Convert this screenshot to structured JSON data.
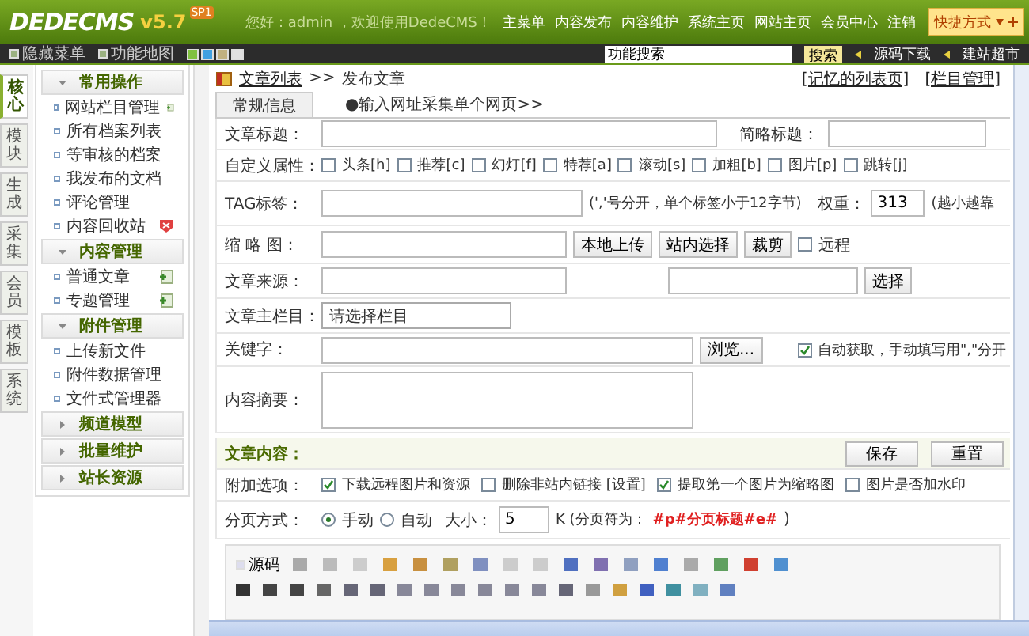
{
  "header": {
    "logo": "DEDECMS",
    "version": "v5.7",
    "badge": "SP1",
    "greeting": "您好：admin ，欢迎使用DedeCMS！",
    "nav": [
      "主菜单",
      "内容发布",
      "内容维护",
      "系统主页",
      "网站主页",
      "会员中心",
      "注销"
    ],
    "shortcut": "快捷方式"
  },
  "toolbar": {
    "items": [
      "隐藏菜单",
      "功能地图"
    ],
    "search_value": "功能搜索",
    "search_button": "搜索",
    "links": [
      "源码下载",
      "建站超市"
    ]
  },
  "side_tabs": [
    {
      "label": "核心",
      "selected": true
    },
    {
      "label": "模块",
      "selected": false
    },
    {
      "label": "生成",
      "selected": false
    },
    {
      "label": "采集",
      "selected": false
    },
    {
      "label": "会员",
      "selected": false
    },
    {
      "label": "模板",
      "selected": false
    },
    {
      "label": "系统",
      "selected": false
    }
  ],
  "menu": [
    {
      "title": "常用操作",
      "expanded": true,
      "items": [
        {
          "label": "网站栏目管理",
          "kind": "add"
        },
        {
          "label": "所有档案列表"
        },
        {
          "label": "等审核的档案"
        },
        {
          "label": "我发布的文档"
        },
        {
          "label": "评论管理"
        },
        {
          "label": "内容回收站",
          "kind": "delete"
        }
      ]
    },
    {
      "title": "内容管理",
      "expanded": true,
      "items": [
        {
          "label": "普通文章",
          "kind": "add"
        },
        {
          "label": "专题管理",
          "kind": "add"
        }
      ]
    },
    {
      "title": "附件管理",
      "expanded": true,
      "items": [
        {
          "label": "上传新文件"
        },
        {
          "label": "附件数据管理"
        },
        {
          "label": "文件式管理器"
        }
      ]
    },
    {
      "title": "频道模型",
      "expanded": false
    },
    {
      "title": "批量维护",
      "expanded": false
    },
    {
      "title": "站长资源",
      "expanded": false
    }
  ],
  "main": {
    "breadcrumb_link": "文章列表",
    "breadcrumb_sep": ">>",
    "breadcrumb_current": "发布文章",
    "right_links": [
      "[记忆的列表页]",
      "[栏目管理]"
    ],
    "tabs": [
      {
        "label": "常规信息",
        "selected": true
      },
      {
        "label": "●输入网址采集单个网页>>",
        "selected": false
      }
    ],
    "title_row": {
      "label": "文章标题：",
      "short_label": "简略标题："
    },
    "attr_row": {
      "label": "自定义属性：",
      "flags": [
        {
          "label": "头条[h]",
          "checked": false
        },
        {
          "label": "推荐[c]",
          "checked": false
        },
        {
          "label": "幻灯[f]",
          "checked": false
        },
        {
          "label": "特荐[a]",
          "checked": false
        },
        {
          "label": "滚动[s]",
          "checked": false
        },
        {
          "label": "加粗[b]",
          "checked": false
        },
        {
          "label": "图片[p]",
          "checked": false
        },
        {
          "label": "跳转[j]",
          "checked": false
        }
      ]
    },
    "tag_row": {
      "label": "TAG标签：",
      "hint": "(','号分开，单个标签小于12字节)",
      "weight_label": "权重：",
      "weight_value": "313",
      "weight_hint": "(越小越靠"
    },
    "thumb_row": {
      "label": "缩 略 图：",
      "buttons": [
        "本地上传",
        "站内选择",
        "裁剪"
      ],
      "remote": {
        "label": "远程",
        "checked": false
      }
    },
    "source_row": {
      "label": "文章来源：",
      "button": "选择"
    },
    "column_row": {
      "label": "文章主栏目：",
      "value": "请选择栏目"
    },
    "keyword_row": {
      "label": "关键字：",
      "button": "浏览...",
      "auto": {
        "label": "自动获取，手动填写用\",\"分开",
        "checked": true
      }
    },
    "summary_row": {
      "label": "内容摘要："
    },
    "content_section": {
      "title": "文章内容：",
      "buttons": [
        "保存",
        "重置"
      ]
    },
    "options_row": {
      "label": "附加选项：",
      "items": [
        {
          "label": "下载远程图片和资源",
          "checked": true
        },
        {
          "label": "删除非站内链接 [设置]",
          "checked": false
        },
        {
          "label": "提取第一个图片为缩略图",
          "checked": true
        },
        {
          "label": "图片是否加水印",
          "checked": false
        }
      ]
    },
    "paging_row": {
      "label": "分页方式：",
      "modes": [
        {
          "label": "手动",
          "selected": true
        },
        {
          "label": "自动",
          "selected": false
        }
      ],
      "size_label": "大小：",
      "size_value": "5",
      "unit_hint": "K (分页符为：",
      "marker": "#p#分页标题#e#",
      "close": ")"
    },
    "editor": {
      "source_button": "源码"
    }
  }
}
